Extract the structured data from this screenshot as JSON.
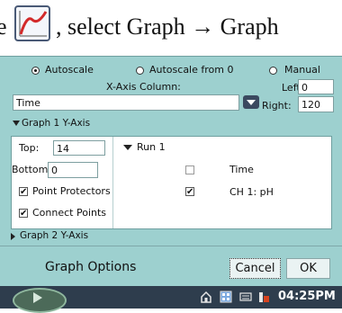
{
  "instruction": {
    "prefix": "e",
    "text": ", select Graph → Graph",
    "icon": "graph-icon"
  },
  "axis_mode": {
    "options": [
      {
        "label": "Autoscale",
        "selected": true
      },
      {
        "label": "Autoscale from 0",
        "selected": false
      },
      {
        "label": "Manual",
        "selected": false
      }
    ]
  },
  "x_axis": {
    "column_label": "X-Axis Column:",
    "column_value": "Time",
    "left_label": "Left:",
    "left_value": "0",
    "right_label": "Right:",
    "right_value": "120"
  },
  "graph1": {
    "header": "Graph 1 Y-Axis",
    "top_label": "Top:",
    "top_value": "14",
    "bottom_label": "Bottom:",
    "bottom_value": "0",
    "point_protectors_label": "Point Protectors",
    "point_protectors_checked": true,
    "connect_points_label": "Connect Points",
    "connect_points_checked": true,
    "run_label": "Run 1",
    "columns": [
      {
        "label": "Time",
        "checked": false
      },
      {
        "label": "CH 1: pH",
        "checked": true
      }
    ]
  },
  "graph2": {
    "header": "Graph 2 Y-Axis"
  },
  "footer": {
    "title": "Graph Options",
    "cancel_label": "Cancel",
    "ok_label": "OK"
  },
  "taskbar": {
    "clock": "04:25PM"
  },
  "colors": {
    "dialog_bg": "#9dd0cf",
    "taskbar_bg": "#2e3d4d"
  }
}
